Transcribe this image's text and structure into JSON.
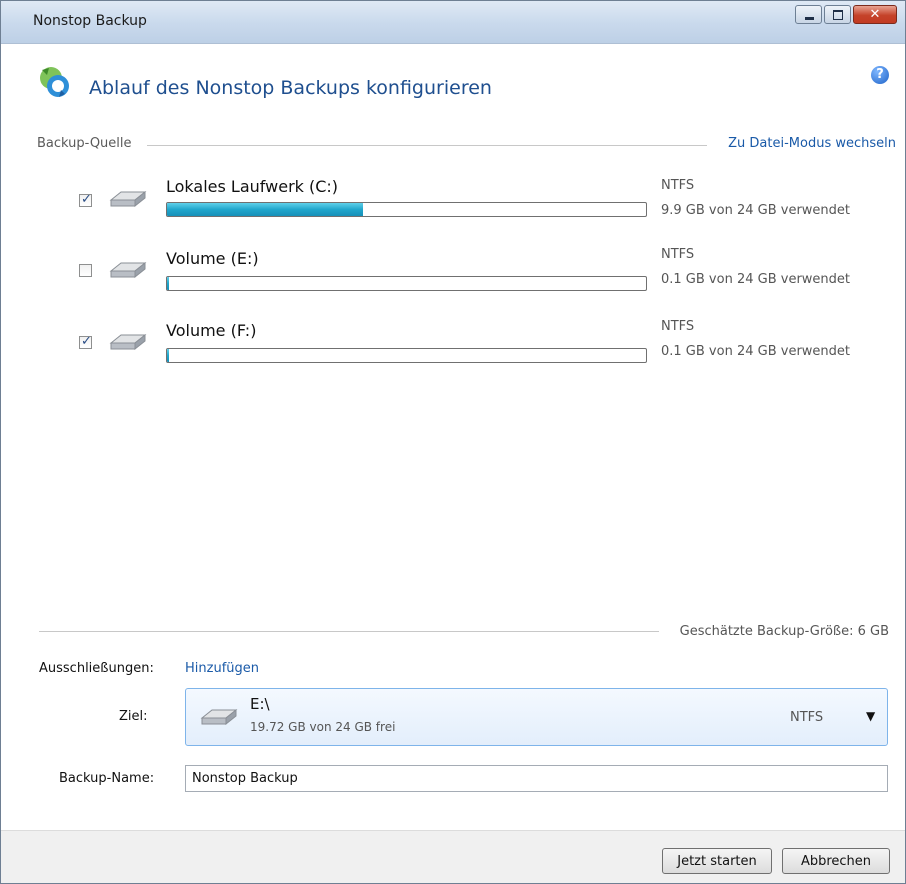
{
  "window": {
    "title": "Nonstop Backup"
  },
  "header": {
    "title": "Ablauf des Nonstop Backups konfigurieren",
    "help_icon": "help-icon"
  },
  "source": {
    "label": "Backup-Quelle",
    "mode_link": "Zu Datei-Modus wechseln",
    "drives": [
      {
        "name": "Lokales Laufwerk (C:)",
        "checked": true,
        "fs": "NTFS",
        "usage": "9.9 GB von 24 GB verwendet",
        "used_fraction": 0.41
      },
      {
        "name": "Volume (E:)",
        "checked": false,
        "fs": "NTFS",
        "usage": "0.1 GB von 24 GB verwendet",
        "used_fraction": 0.004
      },
      {
        "name": "Volume (F:)",
        "checked": true,
        "fs": "NTFS",
        "usage": "0.1 GB von 24 GB verwendet",
        "used_fraction": 0.004
      }
    ]
  },
  "estimate": {
    "text": "Geschätzte Backup-Größe: 6 GB"
  },
  "exclusions": {
    "label": "Ausschließungen:",
    "link": "Hinzufügen"
  },
  "destination": {
    "label": "Ziel:",
    "path": "E:\\",
    "free": "19.72 GB von 24 GB frei",
    "fs": "NTFS"
  },
  "backup_name": {
    "label": "Backup-Name:",
    "value": "Nonstop Backup"
  },
  "buttons": {
    "start": "Jetzt starten",
    "cancel": "Abbrechen"
  },
  "colors": {
    "accent": "#1f4f8f",
    "link": "#1a5aa8",
    "bar_fill": "#20a6cc"
  }
}
